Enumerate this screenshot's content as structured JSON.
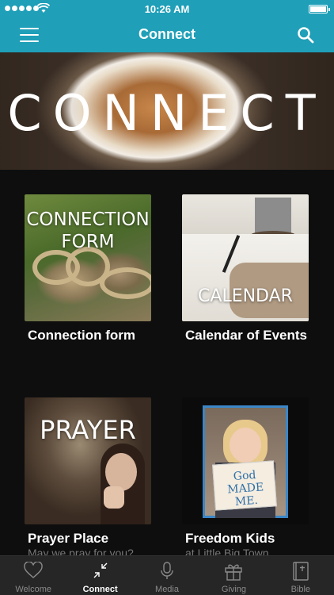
{
  "status_bar": {
    "time": "10:26 AM"
  },
  "nav": {
    "title": "Connect"
  },
  "hero": {
    "title": "CONNECT"
  },
  "tiles": [
    {
      "overlay": "CONNECTION FORM",
      "title": "Connection form",
      "subtitle": ""
    },
    {
      "overlay": "CALENDAR",
      "title": "Calendar of Events",
      "subtitle": ""
    },
    {
      "overlay": "PRAYER",
      "title": "Prayer Place",
      "subtitle": "May we pray for you?"
    },
    {
      "overlay": "",
      "title": "Freedom Kids",
      "subtitle": "at Little Big Town",
      "sign_text": "God MADE ME."
    }
  ],
  "tab_bar": {
    "tabs": [
      {
        "label": "Welcome",
        "icon": "heart-icon"
      },
      {
        "label": "Connect",
        "icon": "connect-arrows-icon"
      },
      {
        "label": "Media",
        "icon": "microphone-icon"
      },
      {
        "label": "Giving",
        "icon": "gift-icon"
      },
      {
        "label": "Bible",
        "icon": "book-icon"
      }
    ],
    "active": "Connect"
  },
  "colors": {
    "accent": "#1f9fb8",
    "background": "#0e0e0e",
    "tab_bar": "#262626"
  }
}
